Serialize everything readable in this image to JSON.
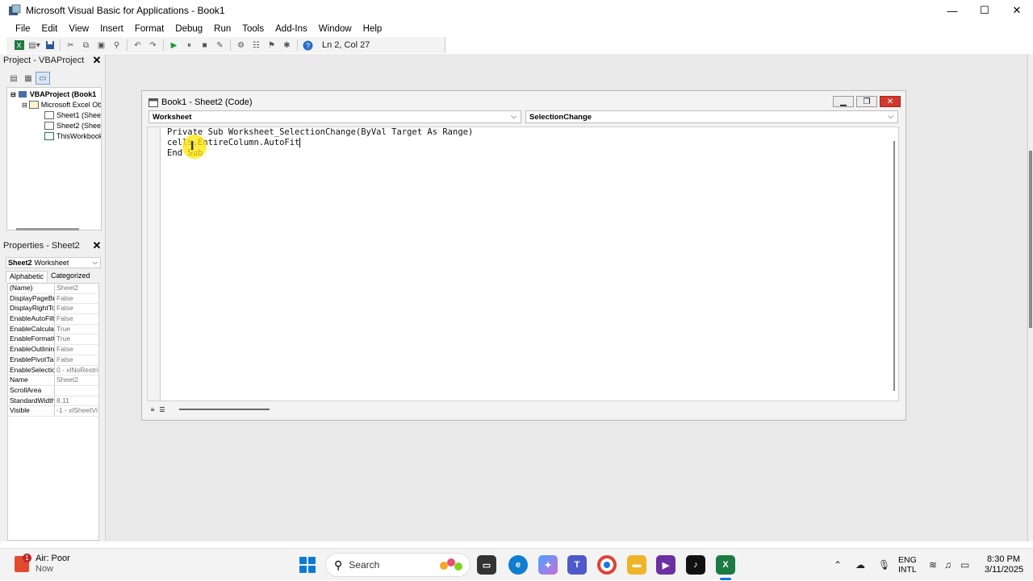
{
  "window": {
    "title": "Microsoft Visual Basic for Applications - Book1",
    "minimize": "—",
    "maximize": "☐",
    "close": "✕"
  },
  "menu": [
    "File",
    "Edit",
    "View",
    "Insert",
    "Format",
    "Debug",
    "Run",
    "Tools",
    "Add-Ins",
    "Window",
    "Help"
  ],
  "toolbar": {
    "cursor_position": "Ln 2, Col 27"
  },
  "project": {
    "title": "Project - VBAProject",
    "tree": [
      "VBAProject (Book1",
      "Microsoft Excel Ob",
      "Sheet1 (Shee",
      "Sheet2 (Shee",
      "ThisWorkbook"
    ]
  },
  "properties": {
    "title": "Properties - Sheet2",
    "object_name": "Sheet2",
    "object_type": "Worksheet",
    "tab_alpha": "Alphabetic",
    "tab_cat": "Categorized",
    "rows": [
      {
        "name": "(Name)",
        "value": "Sheet2"
      },
      {
        "name": "DisplayPageBre",
        "value": "False"
      },
      {
        "name": "DisplayRightTo",
        "value": "False"
      },
      {
        "name": "EnableAutoFilte",
        "value": "False"
      },
      {
        "name": "EnableCalculati",
        "value": "True"
      },
      {
        "name": "EnableFormatC",
        "value": "True"
      },
      {
        "name": "EnableOutlining",
        "value": "False"
      },
      {
        "name": "EnablePivotTab",
        "value": "False"
      },
      {
        "name": "EnableSelectio",
        "value": "0 - xlNoRestri"
      },
      {
        "name": "Name",
        "value": "Sheet2"
      },
      {
        "name": "ScrollArea",
        "value": ""
      },
      {
        "name": "StandardWidth",
        "value": "8.11"
      },
      {
        "name": "Visible",
        "value": "-1 - xlSheetVi"
      }
    ]
  },
  "code_window": {
    "title": "Book1 - Sheet2 (Code)",
    "object_combo": "Worksheet",
    "procedure_combo": "SelectionChange",
    "lines": [
      "Private Sub Worksheet_SelectionChange(ByVal Target As Range)",
      "cells.EntireColumn.AutoFit",
      "End Sub"
    ]
  },
  "taskbar": {
    "weather_title": "Air: Poor",
    "weather_sub": "Now",
    "weather_badge": "1",
    "search_text": "Search",
    "lang_1": "ENG",
    "lang_2": "INTL",
    "time": "8:30 PM",
    "date": "3/11/2025"
  }
}
